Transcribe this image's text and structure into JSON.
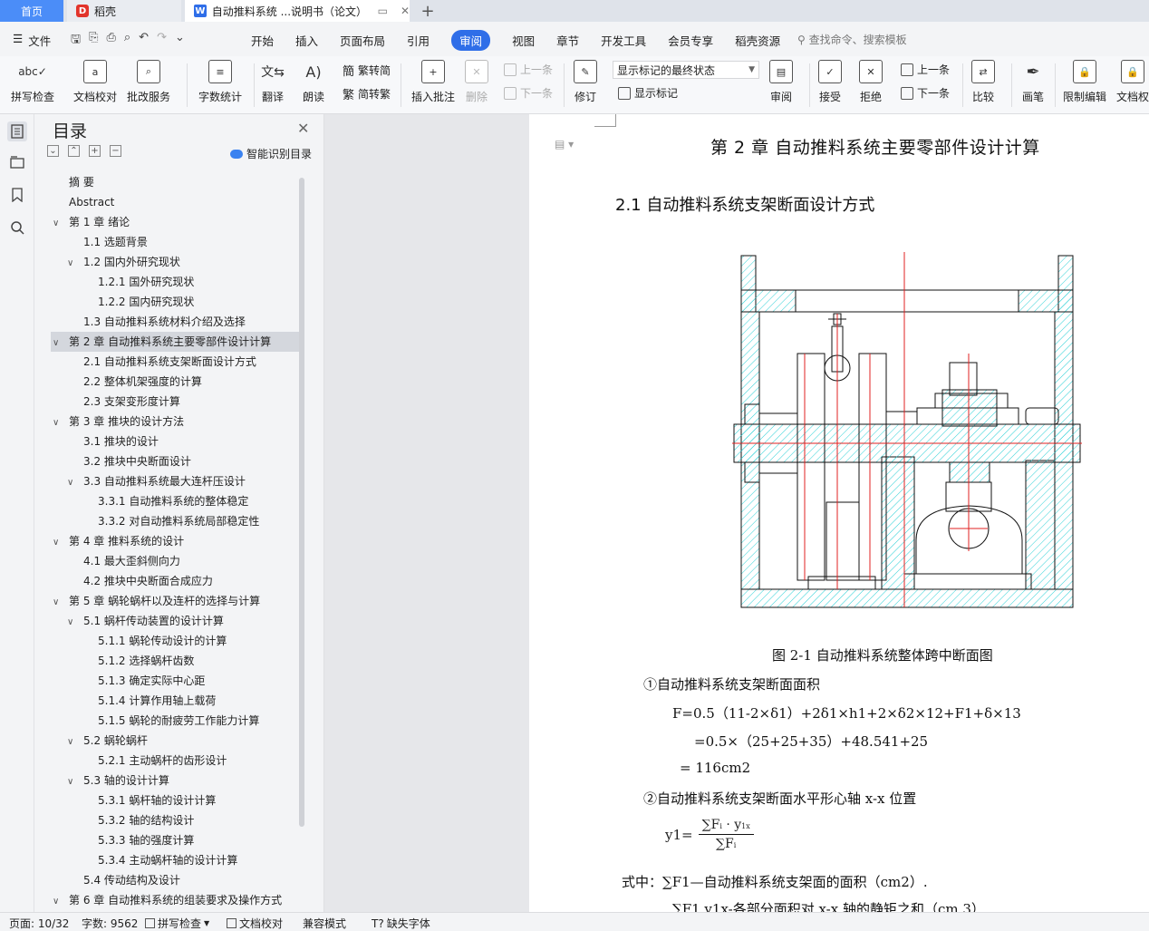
{
  "tabs": {
    "home": "首页",
    "shell": "稻壳",
    "doc": "自动推料系统 ...说明书（论文）"
  },
  "menu": {
    "file": "文件",
    "items": [
      "开始",
      "插入",
      "页面布局",
      "引用",
      "审阅",
      "视图",
      "章节",
      "开发工具",
      "会员专享",
      "稻壳资源"
    ],
    "active": "审阅",
    "search": "查找命令、搜索模板"
  },
  "ribbon": {
    "spell": "拼写检查",
    "proof": "文档校对",
    "batch": "批改服务",
    "wordcount": "字数统计",
    "translate": "翻译",
    "read": "朗读",
    "to_trad": "繁转简",
    "to_simp": "简转繁",
    "insert_comment": "插入批注",
    "delete": "删除",
    "prev": "上一条",
    "next": "下一条",
    "revise": "修订",
    "markup_select": "显示标记的最终状态",
    "show_markup": "显示标记",
    "review": "审阅",
    "accept": "接受",
    "reject": "拒绝",
    "prev2": "上一条",
    "next2": "下一条",
    "compare": "比较",
    "pen": "画笔",
    "restrict": "限制编辑",
    "doc_rights": "文档权"
  },
  "toc": {
    "title": "目录",
    "smart": "智能识别目录",
    "items": [
      {
        "level": 0,
        "text": "摘    要",
        "chevron": ""
      },
      {
        "level": 0,
        "text": "Abstract",
        "chevron": ""
      },
      {
        "level": 0,
        "text": "第 1 章  绪论",
        "chevron": "down"
      },
      {
        "level": 1,
        "text": "1.1 选题背景",
        "chevron": ""
      },
      {
        "level": 1,
        "text": "1.2 国内外研究现状",
        "chevron": "down"
      },
      {
        "level": 2,
        "text": "1.2.1 国外研究现状",
        "chevron": ""
      },
      {
        "level": 2,
        "text": "1.2.2 国内研究现状",
        "chevron": ""
      },
      {
        "level": 1,
        "text": "1.3 自动推料系统材料介绍及选择",
        "chevron": ""
      },
      {
        "level": 0,
        "text": "第 2 章  自动推料系统主要零部件设计计算",
        "chevron": "down",
        "selected": true
      },
      {
        "level": 1,
        "text": "2.1 自动推料系统支架断面设计方式",
        "chevron": ""
      },
      {
        "level": 1,
        "text": "2.2 整体机架强度的计算",
        "chevron": ""
      },
      {
        "level": 1,
        "text": "2.3 支架变形度计算",
        "chevron": ""
      },
      {
        "level": 0,
        "text": "第 3 章  推块的设计方法",
        "chevron": "down"
      },
      {
        "level": 1,
        "text": "3.1 推块的设计",
        "chevron": ""
      },
      {
        "level": 1,
        "text": "3.2 推块中央断面设计",
        "chevron": ""
      },
      {
        "level": 1,
        "text": "3.3 自动推料系统最大连杆压设计",
        "chevron": "down"
      },
      {
        "level": 2,
        "text": "3.3.1 自动推料系统的整体稳定",
        "chevron": ""
      },
      {
        "level": 2,
        "text": "3.3.2 对自动推料系统局部稳定性",
        "chevron": ""
      },
      {
        "level": 0,
        "text": "第 4 章  推料系统的设计",
        "chevron": "down"
      },
      {
        "level": 1,
        "text": "4.1 最大歪斜侧向力",
        "chevron": ""
      },
      {
        "level": 1,
        "text": "4.2 推块中央断面合成应力",
        "chevron": ""
      },
      {
        "level": 0,
        "text": "第 5 章  蜗轮蜗杆以及连杆的选择与计算",
        "chevron": "down"
      },
      {
        "level": 1,
        "text": "5.1 蜗杆传动装置的设计计算",
        "chevron": "down"
      },
      {
        "level": 2,
        "text": "5.1.1 蜗轮传动设计的计算",
        "chevron": ""
      },
      {
        "level": 2,
        "text": "5.1.2 选择蜗杆齿数",
        "chevron": ""
      },
      {
        "level": 2,
        "text": "5.1.3 确定实际中心距",
        "chevron": ""
      },
      {
        "level": 2,
        "text": "5.1.4 计算作用轴上载荷",
        "chevron": ""
      },
      {
        "level": 2,
        "text": "5.1.5 蜗轮的耐疲劳工作能力计算",
        "chevron": ""
      },
      {
        "level": 1,
        "text": "5.2 蜗轮蜗杆",
        "chevron": "down"
      },
      {
        "level": 2,
        "text": "5.2.1 主动蜗杆的齿形设计",
        "chevron": ""
      },
      {
        "level": 1,
        "text": "5.3 轴的设计计算",
        "chevron": "down"
      },
      {
        "level": 2,
        "text": "5.3.1 蜗杆轴的设计计算",
        "chevron": ""
      },
      {
        "level": 2,
        "text": "5.3.2 轴的结构设计",
        "chevron": ""
      },
      {
        "level": 2,
        "text": "5.3.3 轴的强度计算",
        "chevron": ""
      },
      {
        "level": 2,
        "text": "5.3.4 主动蜗杆轴的设计计算",
        "chevron": ""
      },
      {
        "level": 1,
        "text": "5.4 传动结构及设计",
        "chevron": ""
      },
      {
        "level": 0,
        "text": "第 6 章  自动推料系统的组装要求及操作方式",
        "chevron": "down"
      }
    ]
  },
  "doc": {
    "chapter_title": "第 2 章  自动推料系统主要零部件设计计算",
    "section_title": "2.1 自动推料系统支架断面设计方式",
    "figure_caption": "图 2-1  自动推料系统整体跨中断面图",
    "line1": "①自动推料系统支架断面面积",
    "line2": "F=0.5（11-2×δ1）+2δ1×h1+2×δ2×12+F1+δ×13",
    "line3": "=0.5×（25+25+35）+48.541+25",
    "line4": "= 116cm2",
    "line5": "②自动推料系统支架断面水平形心轴 x-x 位置",
    "frac_lhs": "y1=",
    "frac_num": "∑F",
    "frac_num_sub": "i",
    "frac_num_mid": " · y",
    "frac_num_sub2": "1x",
    "frac_den": "∑F",
    "frac_den_sub": "i",
    "line6": "式中：∑F1—自动推料系统支架面的面积（cm2）.",
    "line7": "∑F1 y1x-各部分面积对 x-x 轴的静矩之和（cm 3）"
  },
  "status": {
    "page": "页面: 10/32",
    "words": "字数: 9562",
    "spell": "拼写检查",
    "proof": "文档校对",
    "compat": "兼容模式",
    "missing_font": "缺失字体"
  }
}
